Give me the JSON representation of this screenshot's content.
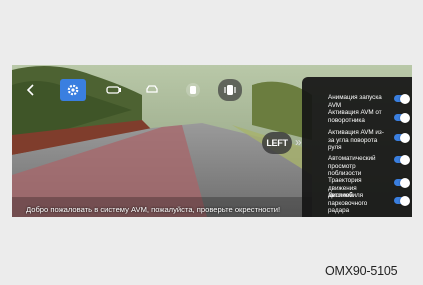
{
  "nav": {
    "back_icon": "back-arrow-icon",
    "settings_icon": "gear-icon",
    "views": [
      "top-view-car-icon",
      "front-view-car-icon",
      "rear-view-car-icon",
      "side-view-car-icon"
    ]
  },
  "view_direction": "LEFT",
  "settings_panel": {
    "items": [
      {
        "label": "Анимация запуска AVM",
        "enabled": true
      },
      {
        "label": "Активация AVM от поворотника",
        "enabled": true
      },
      {
        "label": "Активация AVM из-за угла поворота руля",
        "enabled": true
      },
      {
        "label": "Автоматический просмотр поблизости",
        "enabled": true
      },
      {
        "label": "Траектория движения автомобиля",
        "enabled": true
      },
      {
        "label": "Дисплей парковочного радара",
        "enabled": true
      }
    ],
    "accent_color": "#3a7fe0"
  },
  "welcome_message": "Добро пожаловать в систему AVM, пожалуйста, проверьте окрестности!",
  "figure_code": "OMX90-5105"
}
